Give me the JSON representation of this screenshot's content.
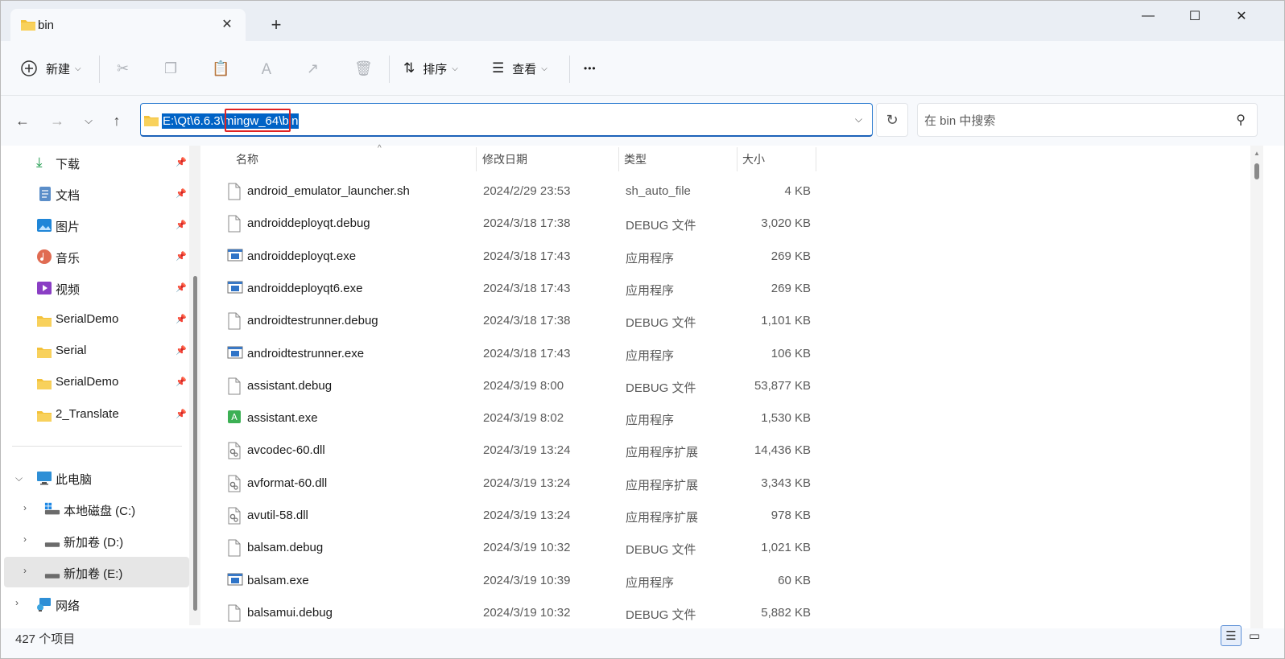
{
  "window": {
    "tab_title": "bin",
    "new_tab_symbol": "+",
    "close_tab_symbol": "✕",
    "minimize_symbol": "—",
    "maximize_symbol": "☐",
    "close_symbol": "✕"
  },
  "toolbar": {
    "new_label": "新建",
    "sort_label": "排序",
    "view_label": "查看",
    "more_label": "•••"
  },
  "address_bar": {
    "path": "E:\\Qt\\6.6.3\\mingw_64\\bin",
    "search_placeholder": "在 bin 中搜索"
  },
  "sidebar": {
    "quick_access": [
      {
        "label": "下载",
        "icon": "download-icon",
        "pinned": true
      },
      {
        "label": "文档",
        "icon": "document-icon",
        "pinned": true
      },
      {
        "label": "图片",
        "icon": "picture-icon",
        "pinned": true
      },
      {
        "label": "音乐",
        "icon": "music-icon",
        "pinned": true
      },
      {
        "label": "视频",
        "icon": "video-icon",
        "pinned": true
      },
      {
        "label": "SerialDemo",
        "icon": "folder-icon",
        "pinned": true
      },
      {
        "label": "Serial",
        "icon": "folder-icon",
        "pinned": true
      },
      {
        "label": "SerialDemo",
        "icon": "folder-icon",
        "pinned": true
      },
      {
        "label": "2_Translate",
        "icon": "folder-icon",
        "pinned": true
      }
    ],
    "this_pc": "此电脑",
    "drives": [
      {
        "label": "本地磁盘 (C:)",
        "icon": "drive-c-icon"
      },
      {
        "label": "新加卷 (D:)",
        "icon": "drive-icon"
      },
      {
        "label": "新加卷 (E:)",
        "icon": "drive-icon",
        "selected": true
      }
    ],
    "network": "网络"
  },
  "columns": {
    "name": "名称",
    "date": "修改日期",
    "type": "类型",
    "size": "大小"
  },
  "files": [
    {
      "name": "android_emulator_launcher.sh",
      "date": "2024/2/29 23:53",
      "type": "sh_auto_file",
      "size": "4 KB",
      "icon": "file-icon"
    },
    {
      "name": "androiddeployqt.debug",
      "date": "2024/3/18 17:38",
      "type": "DEBUG 文件",
      "size": "3,020 KB",
      "icon": "file-icon"
    },
    {
      "name": "androiddeployqt.exe",
      "date": "2024/3/18 17:43",
      "type": "应用程序",
      "size": "269 KB",
      "icon": "exe-icon"
    },
    {
      "name": "androiddeployqt6.exe",
      "date": "2024/3/18 17:43",
      "type": "应用程序",
      "size": "269 KB",
      "icon": "exe-icon"
    },
    {
      "name": "androidtestrunner.debug",
      "date": "2024/3/18 17:38",
      "type": "DEBUG 文件",
      "size": "1,101 KB",
      "icon": "file-icon"
    },
    {
      "name": "androidtestrunner.exe",
      "date": "2024/3/18 17:43",
      "type": "应用程序",
      "size": "106 KB",
      "icon": "exe-icon"
    },
    {
      "name": "assistant.debug",
      "date": "2024/3/19 8:00",
      "type": "DEBUG 文件",
      "size": "53,877 KB",
      "icon": "file-icon"
    },
    {
      "name": "assistant.exe",
      "date": "2024/3/19 8:02",
      "type": "应用程序",
      "size": "1,530 KB",
      "icon": "assistant-app-icon"
    },
    {
      "name": "avcodec-60.dll",
      "date": "2024/3/19 13:24",
      "type": "应用程序扩展",
      "size": "14,436 KB",
      "icon": "dll-icon"
    },
    {
      "name": "avformat-60.dll",
      "date": "2024/3/19 13:24",
      "type": "应用程序扩展",
      "size": "3,343 KB",
      "icon": "dll-icon"
    },
    {
      "name": "avutil-58.dll",
      "date": "2024/3/19 13:24",
      "type": "应用程序扩展",
      "size": "978 KB",
      "icon": "dll-icon"
    },
    {
      "name": "balsam.debug",
      "date": "2024/3/19 10:32",
      "type": "DEBUG 文件",
      "size": "1,021 KB",
      "icon": "file-icon"
    },
    {
      "name": "balsam.exe",
      "date": "2024/3/19 10:39",
      "type": "应用程序",
      "size": "60 KB",
      "icon": "exe-icon"
    },
    {
      "name": "balsamui.debug",
      "date": "2024/3/19 10:32",
      "type": "DEBUG 文件",
      "size": "5,882 KB",
      "icon": "file-icon"
    }
  ],
  "status": {
    "item_count": "427 个项目"
  },
  "colors": {
    "accent": "#0063c6",
    "highlight_box": "#e02323",
    "folder": "#f3c13a"
  }
}
